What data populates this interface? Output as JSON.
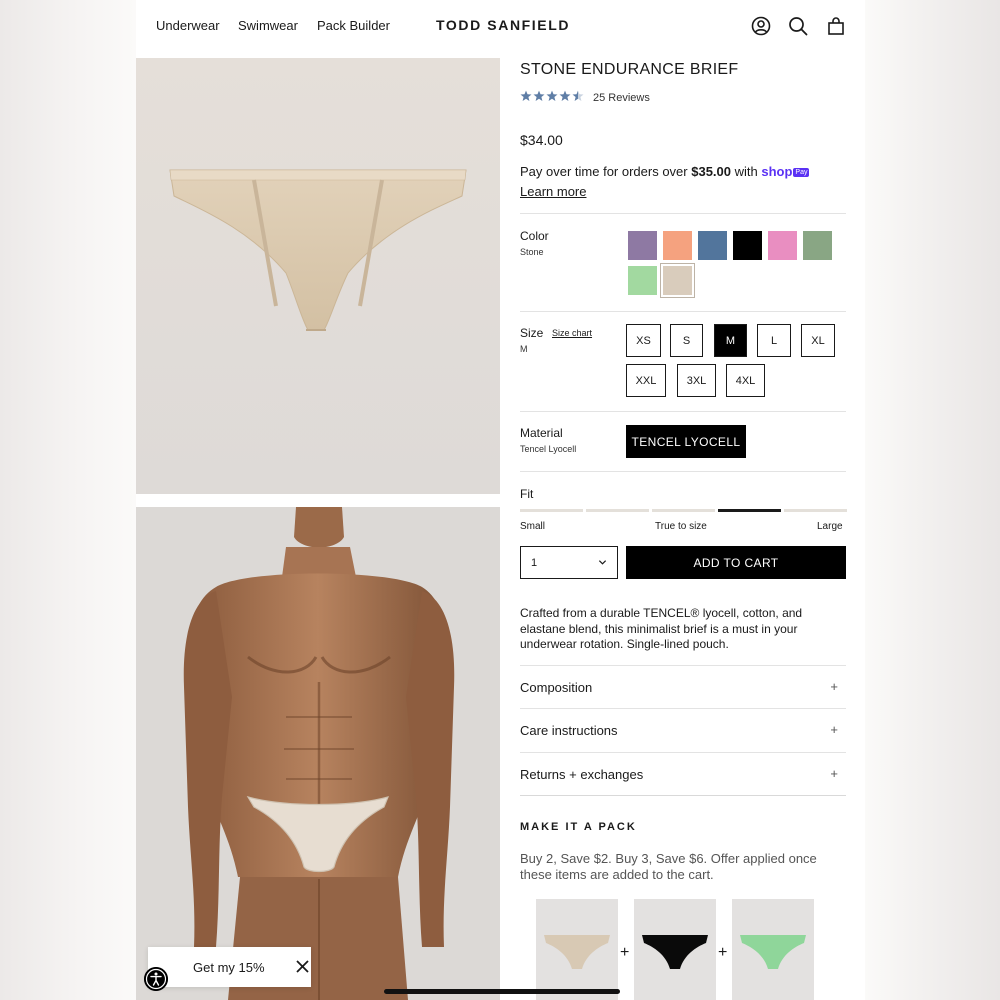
{
  "nav": {
    "links": [
      "Underwear",
      "Swimwear",
      "Pack Builder"
    ],
    "brand": "TODD SANFIELD",
    "icons": [
      "account-icon",
      "search-icon",
      "cart-icon"
    ]
  },
  "product": {
    "title": "STONE ENDURANCE BRIEF",
    "rating": 4.5,
    "reviews": "25 Reviews",
    "price": "$34.00",
    "pay_prefix": "Pay over time for orders over ",
    "pay_threshold": "$35.00",
    "pay_with": " with ",
    "shop_pay": "shop",
    "shop_pay_badge": "Pay",
    "learn_more": "Learn more"
  },
  "color": {
    "label": "Color",
    "selected": "Stone",
    "swatches": [
      {
        "name": "purple",
        "hex": "#8e79a3"
      },
      {
        "name": "orange",
        "hex": "#f5a27f"
      },
      {
        "name": "blue",
        "hex": "#52759c"
      },
      {
        "name": "black",
        "hex": "#000000"
      },
      {
        "name": "pink",
        "hex": "#e98ec1"
      },
      {
        "name": "sage",
        "hex": "#89a684"
      },
      {
        "name": "mint",
        "hex": "#a2d9a0"
      },
      {
        "name": "stone",
        "hex": "#d9ccbc"
      }
    ],
    "selected_index": 7
  },
  "size": {
    "label": "Size",
    "selected": "M",
    "chart_link": "Size chart",
    "options": [
      "XS",
      "S",
      "M",
      "L",
      "XL",
      "XXL",
      "3XL",
      "4XL"
    ],
    "selected_index": 2
  },
  "material": {
    "label": "Material",
    "selected": "Tencel Lyocell",
    "button": "TENCEL LYOCELL"
  },
  "fit": {
    "label": "Fit",
    "segments": 5,
    "active_segment": 3,
    "labels": [
      "Small",
      "True to size",
      "Large"
    ]
  },
  "cart": {
    "quantity": "1",
    "add_to_cart": "ADD TO CART"
  },
  "description": "Crafted from a durable TENCEL® lyocell, cotton, and elastane blend, this minimalist brief is a must in your underwear rotation. Single-lined pouch.",
  "accordions": [
    {
      "label": "Composition",
      "icon": "+"
    },
    {
      "label": "Care instructions",
      "icon": "+"
    },
    {
      "label": "Returns + exchanges",
      "icon": "+"
    }
  ],
  "pack": {
    "title": "MAKE IT A PACK",
    "desc": "Buy 2, Save $2. Buy 3, Save $6. Offer applied once these items are added to the cart.",
    "items": [
      {
        "color": "#d8c9b4"
      },
      {
        "color": "#0a0a0a"
      },
      {
        "color": "#8fd69a"
      }
    ],
    "plus": "+"
  },
  "promo": {
    "text": "Get my 15%"
  },
  "colors": {
    "star": "#5f7ea6",
    "shoppay": "#5a31f4",
    "product_beige": "#ddcdb4"
  }
}
